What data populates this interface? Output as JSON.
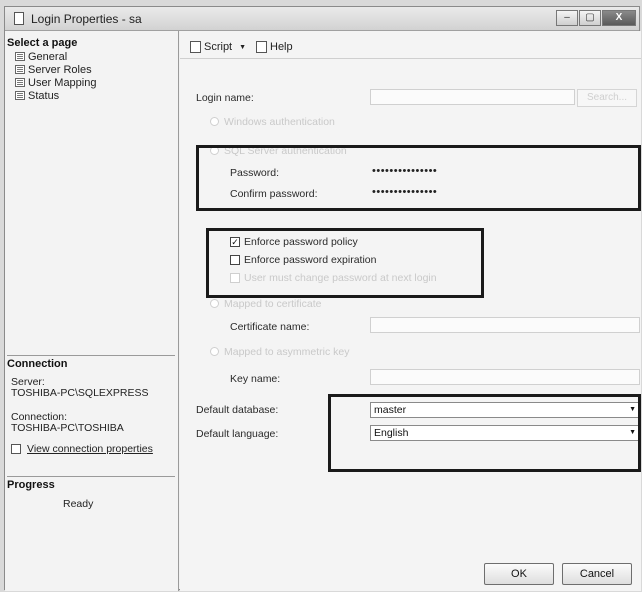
{
  "window": {
    "title": "Login Properties - sa",
    "controls": {
      "min": "–",
      "max": "▢",
      "close": "X"
    }
  },
  "select_page": {
    "header": "Select a page",
    "items": [
      {
        "label": "General",
        "icon": "page-icon"
      },
      {
        "label": "Server Roles",
        "icon": "page-icon"
      },
      {
        "label": "User Mapping",
        "icon": "page-icon"
      },
      {
        "label": "Status",
        "icon": "page-icon"
      }
    ]
  },
  "connection": {
    "header": "Connection",
    "server_label": "Server:",
    "server_value": "TOSHIBA-PC\\SQLEXPRESS",
    "connection_label": "Connection:",
    "connection_value": "TOSHIBA-PC\\TOSHIBA",
    "view_link": "View connection properties"
  },
  "progress": {
    "header": "Progress",
    "status": "Ready"
  },
  "toolbar": {
    "script_label": "Script",
    "help_label": "Help"
  },
  "general": {
    "login_name_label": "Login name:",
    "search_button": "Search...",
    "windows_auth_label": "Windows authentication",
    "sql_auth_label": "SQL Server authentication",
    "password_label": "Password:",
    "password_value": "•••••••••••••••",
    "confirm_label": "Confirm password:",
    "confirm_value": "•••••••••••••••",
    "enforce_policy_label": "Enforce password policy",
    "enforce_policy_checked": true,
    "enforce_policy_mark": "✓",
    "enforce_expiration_label": "Enforce password expiration",
    "enforce_expiration_checked": false,
    "must_change_label": "User must change password at next login",
    "mapped_cert_label": "Mapped to certificate",
    "certificate_label": "Certificate name:",
    "mapped_key_label": "Mapped to asymmetric key",
    "key_label": "Key name:",
    "default_db_label": "Default database:",
    "default_db_value": "master",
    "default_lang_label": "Default language:",
    "default_lang_value": "English"
  },
  "buttons": {
    "ok": "OK",
    "cancel": "Cancel"
  },
  "colors": {
    "window_bg": "#f1f1f1",
    "highlight_border": "#1a1a1a",
    "faded_text": "#c9c9c9"
  }
}
